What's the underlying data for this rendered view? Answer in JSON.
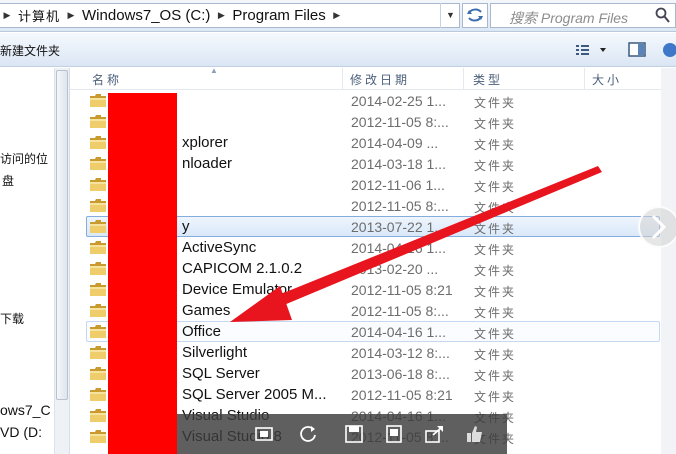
{
  "address": {
    "crumbs": [
      "计算机",
      "Windows7_OS (C:)",
      "Program Files"
    ],
    "search_placeholder": "搜索 Program Files"
  },
  "toolbar": {
    "new_folder_label": "新建文件夹"
  },
  "nav": {
    "items": [
      "访问的位",
      "盘",
      "下载",
      "ows7_C",
      "VD (D:"
    ]
  },
  "columns": {
    "name": "名称",
    "date": "修改日期",
    "type": "类型",
    "size": "大小"
  },
  "rows": [
    {
      "name": "",
      "date": "2014-02-25 1...",
      "type": "文件夹"
    },
    {
      "name": "",
      "date": "2012-11-05 8:...",
      "type": "文件夹"
    },
    {
      "name": "xplorer",
      "date": "2014-04-09 ...",
      "type": "文件夹"
    },
    {
      "name": "nloader",
      "date": "2014-03-18 1...",
      "type": "文件夹"
    },
    {
      "name": "",
      "date": "2012-11-06 1...",
      "type": "文件夹"
    },
    {
      "name": "",
      "date": "2012-11-05 8:...",
      "type": "文件夹"
    },
    {
      "name": "y",
      "date": "2013-07-22 1...",
      "type": "文件夹"
    },
    {
      "name": "ActiveSync",
      "date": "2014-04-16 1...",
      "type": "文件夹"
    },
    {
      "name": "CAPICOM 2.1.0.2",
      "date": "2013-02-20 ...",
      "type": "文件夹"
    },
    {
      "name": "Device Emulator",
      "date": "2012-11-05 8:21",
      "type": "文件夹"
    },
    {
      "name": "Games",
      "date": "2012-11-05 8:...",
      "type": "文件夹"
    },
    {
      "name": "Office",
      "date": "2014-04-16 1...",
      "type": "文件夹"
    },
    {
      "name": "Silverlight",
      "date": "2014-03-12 8:...",
      "type": "文件夹"
    },
    {
      "name": "SQL Server",
      "date": "2013-06-18 8:...",
      "type": "文件夹"
    },
    {
      "name": "SQL Server 2005 M...",
      "date": "2012-11-05 8:21",
      "type": "文件夹"
    },
    {
      "name": "Visual Studio",
      "date": "2014-04-16 1...",
      "type": "文件夹"
    },
    {
      "name": "Visual Studio 8",
      "date": "2012-11-05 8:...",
      "type": "文件夹"
    }
  ],
  "selected_row": 6,
  "hover_row": 11,
  "colors": {
    "annotation_arrow": "#e8141e",
    "redaction": "#ff0000",
    "folder": "#e9c45a"
  }
}
